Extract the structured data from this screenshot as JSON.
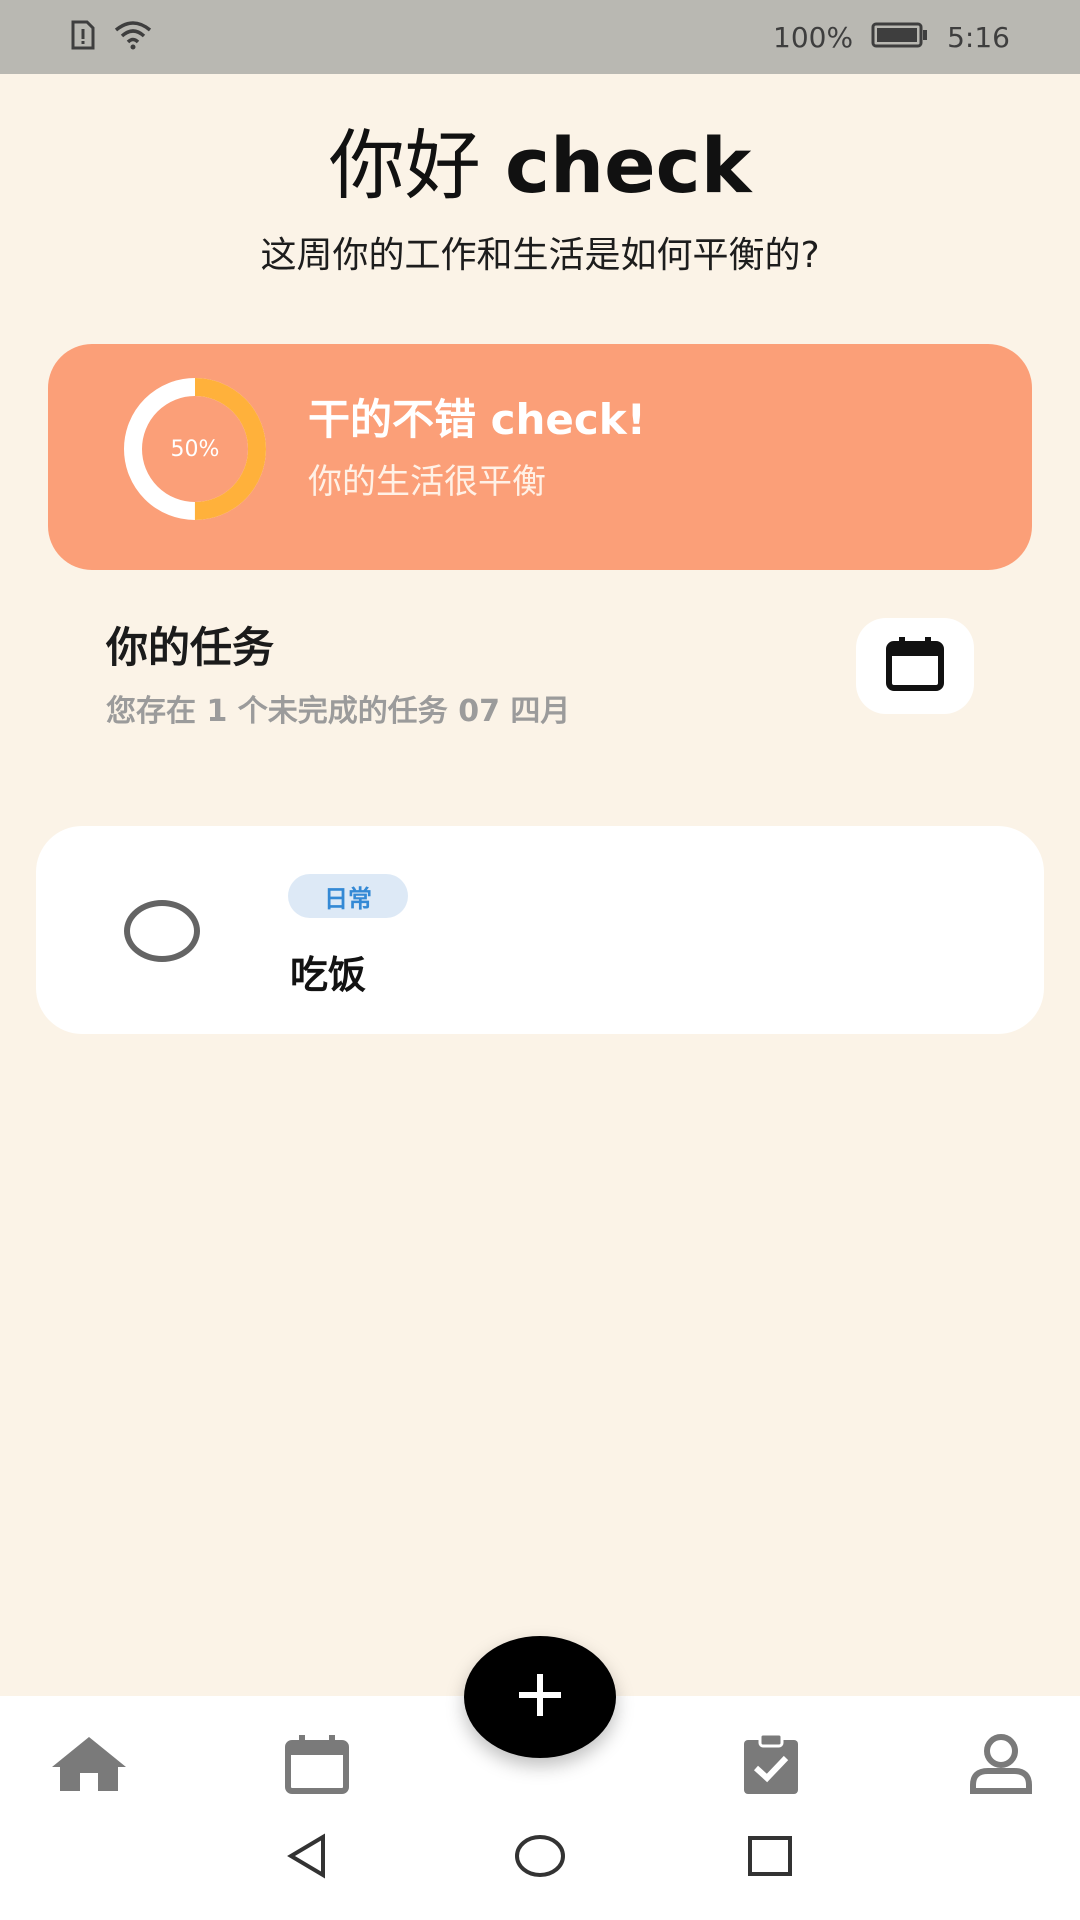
{
  "status_bar": {
    "battery_text": "100%",
    "time": "5:16"
  },
  "header": {
    "greeting": "你好",
    "user_name": "check",
    "subtitle": "这周你的工作和生活是如何平衡的?"
  },
  "summary": {
    "progress_label": "50%",
    "progress_value": 0.5,
    "title": "干的不错 check!",
    "subtitle": "你的生活很平衡",
    "colors": {
      "card": "#fb9f78",
      "ring_track": "#ffffff",
      "ring_fill": "#ffb13b"
    }
  },
  "tasks": {
    "title": "你的任务",
    "subtitle": "您存在 1 个未完成的任务 07 四月",
    "items": [
      {
        "tag": "日常",
        "title": "吃饭",
        "done": false
      }
    ]
  },
  "nav": {
    "items": [
      {
        "icon": "home-icon"
      },
      {
        "icon": "calendar-icon"
      },
      {
        "icon": "task-check-icon"
      },
      {
        "icon": "profile-icon"
      }
    ],
    "fab_icon": "plus-icon"
  }
}
